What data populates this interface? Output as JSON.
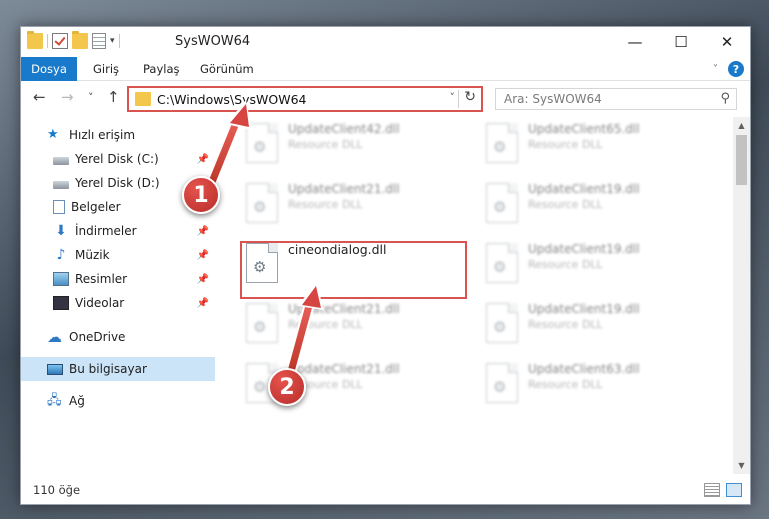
{
  "window": {
    "title": "SysWOW64",
    "caption": {
      "minimize": "—",
      "maximize": "☐",
      "close": "✕"
    }
  },
  "ribbon": {
    "tabs": [
      "Dosya",
      "Giriş",
      "Paylaş",
      "Görünüm"
    ],
    "help": "?"
  },
  "navigation": {
    "back": "←",
    "forward": "→",
    "recent": "˅",
    "up": "↑"
  },
  "address": {
    "path": "C:\\Windows\\SysWOW64",
    "refresh": "↻"
  },
  "search": {
    "placeholder": "Ara: SysWOW64"
  },
  "sidebar": {
    "items": [
      {
        "label": "Hızlı erişim",
        "icon": "star-icon",
        "pinned": false
      },
      {
        "label": "Yerel Disk (C:)",
        "icon": "disk-icon",
        "pinned": true
      },
      {
        "label": "Yerel Disk (D:)",
        "icon": "disk-icon",
        "pinned": true
      },
      {
        "label": "Belgeler",
        "icon": "document-icon",
        "pinned": true
      },
      {
        "label": "İndirmeler",
        "icon": "download-icon",
        "pinned": true
      },
      {
        "label": "Müzik",
        "icon": "music-icon",
        "pinned": true
      },
      {
        "label": "Resimler",
        "icon": "picture-icon",
        "pinned": true
      },
      {
        "label": "Videolar",
        "icon": "video-icon",
        "pinned": true
      },
      {
        "label": "OneDrive",
        "icon": "cloud-icon",
        "pinned": false
      },
      {
        "label": "Bu bilgisayar",
        "icon": "computer-icon",
        "pinned": false,
        "selected": true
      },
      {
        "label": "Ağ",
        "icon": "network-icon",
        "pinned": false
      }
    ]
  },
  "files": {
    "left_column": [
      {
        "name": "UpdateClient42.dll",
        "type": "Resource DLL"
      },
      {
        "name": "UpdateClient21.dll",
        "type": "Resource DLL"
      },
      {
        "name": "cineondialog.dll",
        "type": ""
      },
      {
        "name": "UpdateClient21.dll",
        "type": "Resource DLL"
      },
      {
        "name": "UpdateClient21.dll",
        "type": "Resource DLL"
      }
    ],
    "right_column": [
      {
        "name": "UpdateClient65.dll",
        "type": "Resource DLL"
      },
      {
        "name": "UpdateClient19.dll",
        "type": "Resource DLL"
      },
      {
        "name": "UpdateClient19.dll",
        "type": "Resource DLL"
      },
      {
        "name": "UpdateClient19.dll",
        "type": "Resource DLL"
      },
      {
        "name": "UpdateClient63.dll",
        "type": "Resource DLL"
      }
    ]
  },
  "status": {
    "item_count": "110 öğe"
  },
  "annotations": {
    "badge_1": "1",
    "badge_2": "2",
    "color": "#d9534f"
  }
}
